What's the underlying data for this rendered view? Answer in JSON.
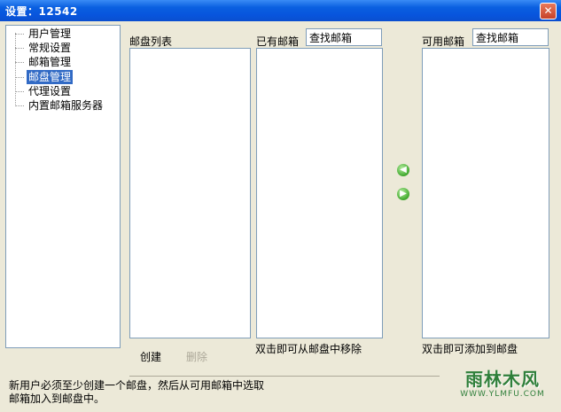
{
  "window": {
    "title": "设置：12542",
    "close_symbol": "✕"
  },
  "tree": {
    "items": [
      {
        "label": "用户管理",
        "selected": false
      },
      {
        "label": "常规设置",
        "selected": false
      },
      {
        "label": "邮箱管理",
        "selected": false
      },
      {
        "label": "邮盘管理",
        "selected": true
      },
      {
        "label": "代理设置",
        "selected": false
      },
      {
        "label": "内置邮箱服务器",
        "selected": false
      }
    ]
  },
  "disk_list": {
    "label": "邮盘列表"
  },
  "existing": {
    "label": "已有邮箱",
    "search_value": "查找邮箱",
    "hint": "双击即可从邮盘中移除"
  },
  "available": {
    "label": "可用邮箱",
    "search_value": "查找邮箱",
    "hint": "双击即可添加到邮盘"
  },
  "arrows": {
    "left_icon": "arrow-left-icon",
    "right_icon": "arrow-right-icon"
  },
  "buttons": {
    "create": "创建",
    "delete": "删除"
  },
  "footer": {
    "line1": "新用户必须至少创建一个邮盘，然后从可用邮箱中选取",
    "line2": "邮箱加入到邮盘中。"
  },
  "watermark": {
    "main": "雨林木风",
    "sub": "WWW.YLMFU.COM"
  }
}
